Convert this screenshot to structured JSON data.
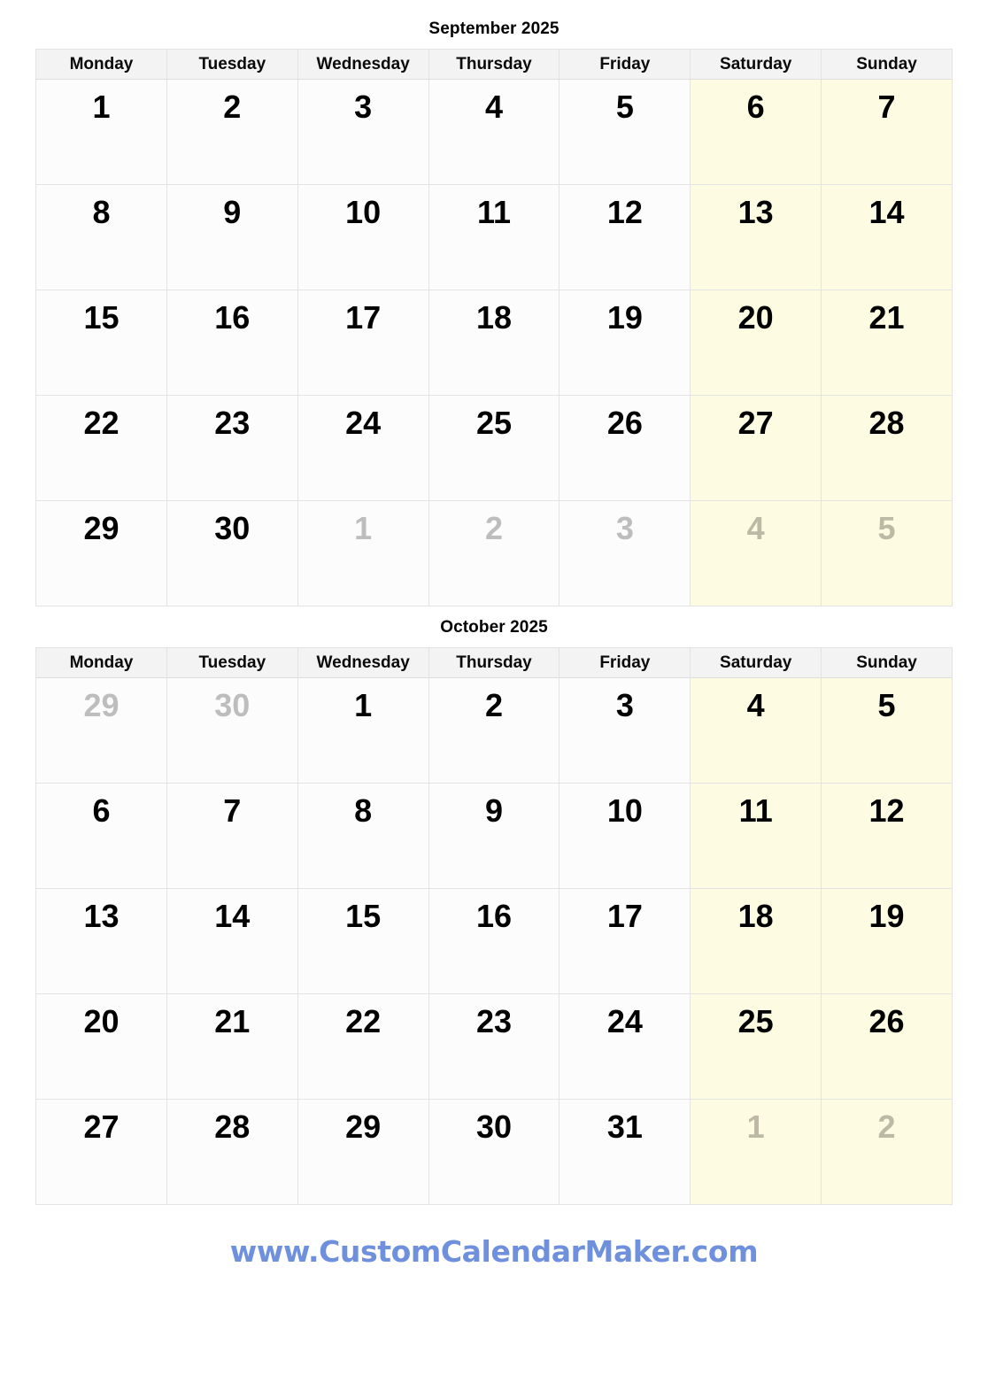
{
  "theme": {
    "weekday_cell_bg": "#FCFCFC",
    "weekend_cell_bg": "#FDFBE1",
    "header_bg": "#F3F3F3",
    "border_color": "#E3E3E3",
    "current_month_text": "#000000",
    "other_month_text": "#BDBDBD",
    "footer_color": "#6F90DC"
  },
  "weekday_headers": [
    "Monday",
    "Tuesday",
    "Wednesday",
    "Thursday",
    "Friday",
    "Saturday",
    "Sunday"
  ],
  "months": [
    {
      "title": "September 2025",
      "weeks": [
        [
          {
            "day": "1",
            "current": true,
            "weekend": false
          },
          {
            "day": "2",
            "current": true,
            "weekend": false
          },
          {
            "day": "3",
            "current": true,
            "weekend": false
          },
          {
            "day": "4",
            "current": true,
            "weekend": false
          },
          {
            "day": "5",
            "current": true,
            "weekend": false
          },
          {
            "day": "6",
            "current": true,
            "weekend": true
          },
          {
            "day": "7",
            "current": true,
            "weekend": true
          }
        ],
        [
          {
            "day": "8",
            "current": true,
            "weekend": false
          },
          {
            "day": "9",
            "current": true,
            "weekend": false
          },
          {
            "day": "10",
            "current": true,
            "weekend": false
          },
          {
            "day": "11",
            "current": true,
            "weekend": false
          },
          {
            "day": "12",
            "current": true,
            "weekend": false
          },
          {
            "day": "13",
            "current": true,
            "weekend": true
          },
          {
            "day": "14",
            "current": true,
            "weekend": true
          }
        ],
        [
          {
            "day": "15",
            "current": true,
            "weekend": false
          },
          {
            "day": "16",
            "current": true,
            "weekend": false
          },
          {
            "day": "17",
            "current": true,
            "weekend": false
          },
          {
            "day": "18",
            "current": true,
            "weekend": false
          },
          {
            "day": "19",
            "current": true,
            "weekend": false
          },
          {
            "day": "20",
            "current": true,
            "weekend": true
          },
          {
            "day": "21",
            "current": true,
            "weekend": true
          }
        ],
        [
          {
            "day": "22",
            "current": true,
            "weekend": false
          },
          {
            "day": "23",
            "current": true,
            "weekend": false
          },
          {
            "day": "24",
            "current": true,
            "weekend": false
          },
          {
            "day": "25",
            "current": true,
            "weekend": false
          },
          {
            "day": "26",
            "current": true,
            "weekend": false
          },
          {
            "day": "27",
            "current": true,
            "weekend": true
          },
          {
            "day": "28",
            "current": true,
            "weekend": true
          }
        ],
        [
          {
            "day": "29",
            "current": true,
            "weekend": false
          },
          {
            "day": "30",
            "current": true,
            "weekend": false
          },
          {
            "day": "1",
            "current": false,
            "weekend": false
          },
          {
            "day": "2",
            "current": false,
            "weekend": false
          },
          {
            "day": "3",
            "current": false,
            "weekend": false
          },
          {
            "day": "4",
            "current": false,
            "weekend": true
          },
          {
            "day": "5",
            "current": false,
            "weekend": true
          }
        ]
      ]
    },
    {
      "title": "October 2025",
      "weeks": [
        [
          {
            "day": "29",
            "current": false,
            "weekend": false
          },
          {
            "day": "30",
            "current": false,
            "weekend": false
          },
          {
            "day": "1",
            "current": true,
            "weekend": false
          },
          {
            "day": "2",
            "current": true,
            "weekend": false
          },
          {
            "day": "3",
            "current": true,
            "weekend": false
          },
          {
            "day": "4",
            "current": true,
            "weekend": true
          },
          {
            "day": "5",
            "current": true,
            "weekend": true
          }
        ],
        [
          {
            "day": "6",
            "current": true,
            "weekend": false
          },
          {
            "day": "7",
            "current": true,
            "weekend": false
          },
          {
            "day": "8",
            "current": true,
            "weekend": false
          },
          {
            "day": "9",
            "current": true,
            "weekend": false
          },
          {
            "day": "10",
            "current": true,
            "weekend": false
          },
          {
            "day": "11",
            "current": true,
            "weekend": true
          },
          {
            "day": "12",
            "current": true,
            "weekend": true
          }
        ],
        [
          {
            "day": "13",
            "current": true,
            "weekend": false
          },
          {
            "day": "14",
            "current": true,
            "weekend": false
          },
          {
            "day": "15",
            "current": true,
            "weekend": false
          },
          {
            "day": "16",
            "current": true,
            "weekend": false
          },
          {
            "day": "17",
            "current": true,
            "weekend": false
          },
          {
            "day": "18",
            "current": true,
            "weekend": true
          },
          {
            "day": "19",
            "current": true,
            "weekend": true
          }
        ],
        [
          {
            "day": "20",
            "current": true,
            "weekend": false
          },
          {
            "day": "21",
            "current": true,
            "weekend": false
          },
          {
            "day": "22",
            "current": true,
            "weekend": false
          },
          {
            "day": "23",
            "current": true,
            "weekend": false
          },
          {
            "day": "24",
            "current": true,
            "weekend": false
          },
          {
            "day": "25",
            "current": true,
            "weekend": true
          },
          {
            "day": "26",
            "current": true,
            "weekend": true
          }
        ],
        [
          {
            "day": "27",
            "current": true,
            "weekend": false
          },
          {
            "day": "28",
            "current": true,
            "weekend": false
          },
          {
            "day": "29",
            "current": true,
            "weekend": false
          },
          {
            "day": "30",
            "current": true,
            "weekend": false
          },
          {
            "day": "31",
            "current": true,
            "weekend": false
          },
          {
            "day": "1",
            "current": false,
            "weekend": true
          },
          {
            "day": "2",
            "current": false,
            "weekend": true
          }
        ]
      ]
    }
  ],
  "footer": {
    "link_text": "www.CustomCalendarMaker.com"
  }
}
